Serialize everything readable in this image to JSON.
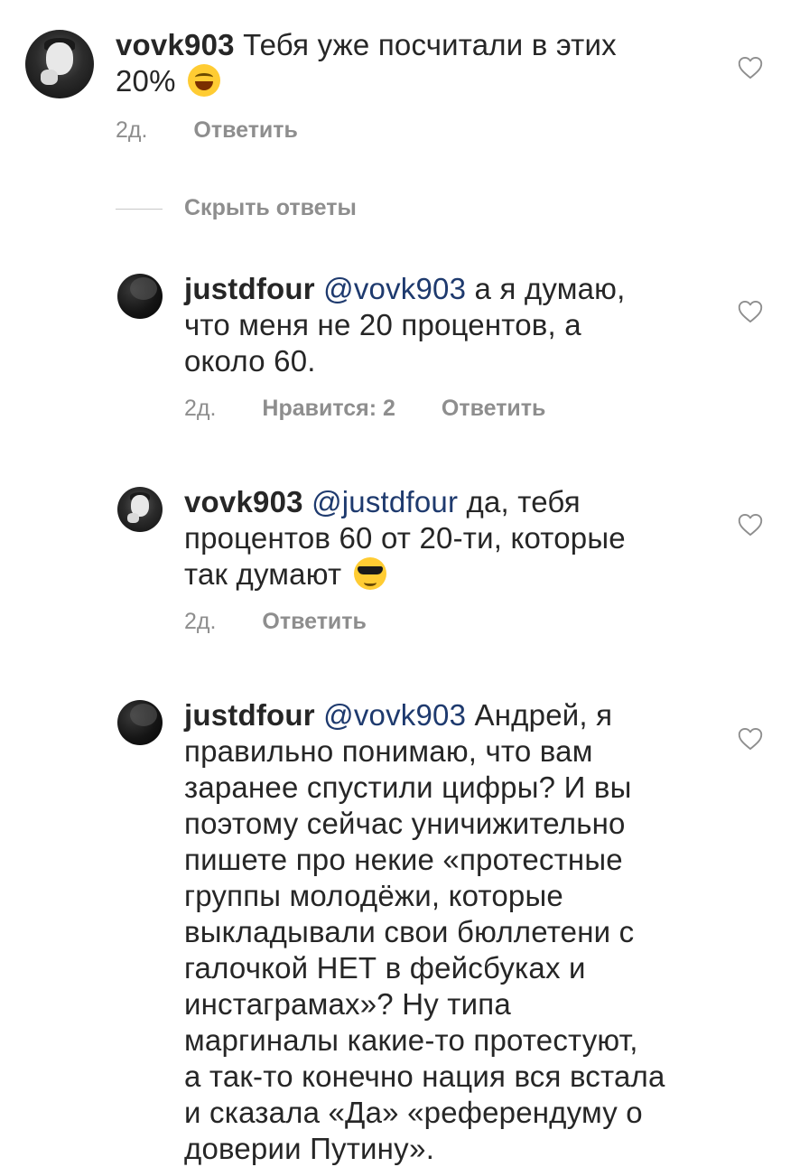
{
  "comments": [
    {
      "username": "vovk903",
      "mention": "",
      "text_line1": "Тебя уже посчитали в этих",
      "text_line2": "20%",
      "emoji": "face-with-tears-of-joy",
      "time": "2д.",
      "likes": "",
      "reply": "Ответить"
    },
    {
      "username": "justdfour",
      "mention": "@vovk903",
      "text_line1": "а я думаю,",
      "text_line2": "что меня не 20 процентов, а",
      "text_line3": "около 60.",
      "time": "2д.",
      "likes": "Нравится: 2",
      "reply": "Ответить"
    },
    {
      "username": "vovk903",
      "mention": "@justdfour",
      "text_line1": "да, тебя",
      "text_line2": "процентов 60 от 20-ти, которые",
      "text_line3": "так думают",
      "emoji": "smiling-face-with-sunglasses",
      "time": "2д.",
      "likes": "",
      "reply": "Ответить"
    },
    {
      "username": "justdfour",
      "mention": "@vovk903",
      "lines": [
        "Андрей, я",
        "правильно понимаю, что вам",
        "заранее спустили цифры? И вы",
        "поэтому сейчас уничижительно",
        "пишете про некие «протестные",
        "группы молодёжи, которые",
        "выкладывали свои бюллетени с",
        "галочкой НЕТ в фейсбуках и",
        "инстаграмах»? Ну типа",
        "маргиналы какие-то протестуют,",
        "а так-то конечно нация вся встала",
        "и сказала «Да» «референдуму о",
        "доверии Путину»."
      ]
    }
  ],
  "hide_replies_label": "Скрыть ответы",
  "icons": {
    "like": "heart-outline-icon"
  },
  "colors": {
    "text": "#262626",
    "meta": "#8e8e8e",
    "mention": "#1e3a6e"
  }
}
